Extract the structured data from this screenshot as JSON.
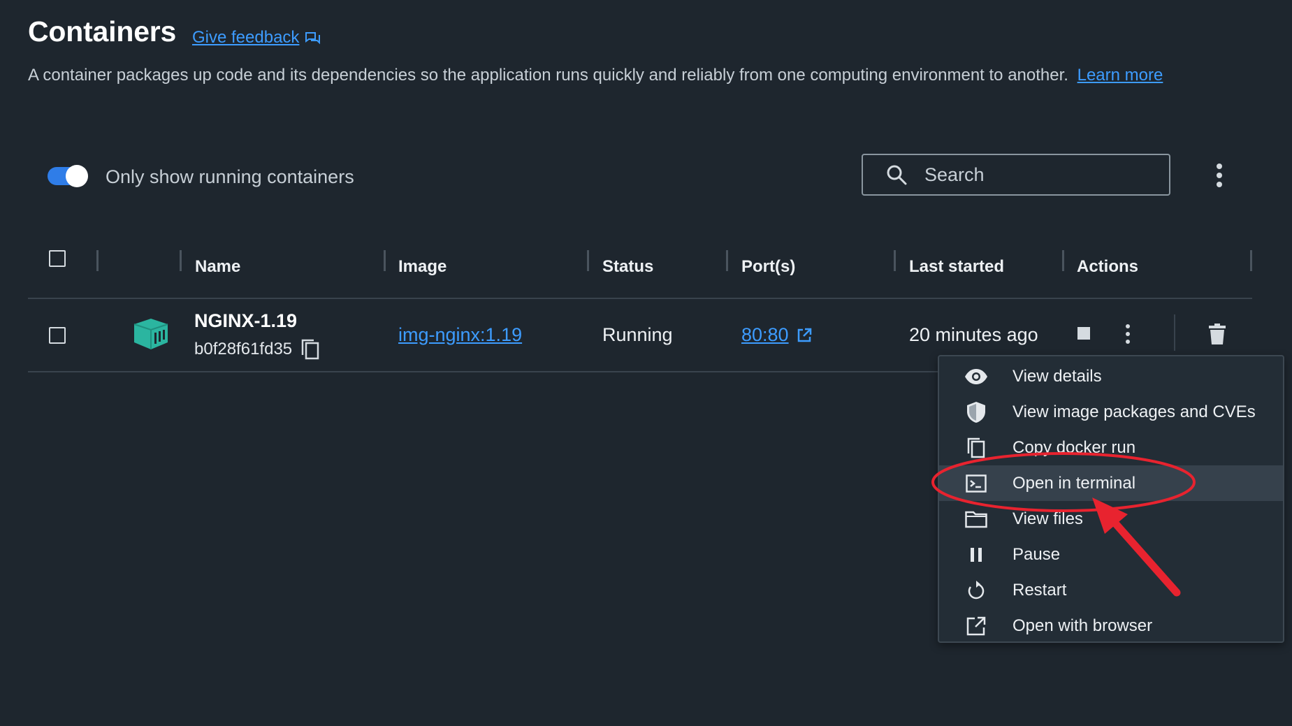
{
  "header": {
    "title": "Containers",
    "feedback_label": "Give feedback",
    "description": "A container packages up code and its dependencies so the application runs quickly and reliably from one computing environment to another.",
    "learn_more": "Learn more"
  },
  "filter": {
    "toggle_label": "Only show running containers",
    "toggle_on": true
  },
  "search": {
    "placeholder": "Search"
  },
  "table": {
    "columns": [
      "Name",
      "Image",
      "Status",
      "Port(s)",
      "Last started",
      "Actions"
    ],
    "rows": [
      {
        "name": "NGINX-1.19",
        "id": "b0f28f61fd35",
        "image": "img-nginx:1.19",
        "status": "Running",
        "port": "80:80",
        "last_started": "20 minutes ago"
      }
    ]
  },
  "menu": {
    "items": [
      {
        "label": "View details",
        "icon": "eye-icon"
      },
      {
        "label": "View image packages and CVEs",
        "icon": "shield-icon"
      },
      {
        "label": "Copy docker run",
        "icon": "copy-icon"
      },
      {
        "label": "Open in terminal",
        "icon": "terminal-icon",
        "highlighted": true
      },
      {
        "label": "View files",
        "icon": "folder-icon"
      },
      {
        "label": "Pause",
        "icon": "pause-icon"
      },
      {
        "label": "Restart",
        "icon": "restart-icon"
      },
      {
        "label": "Open with browser",
        "icon": "external-link-icon"
      }
    ]
  },
  "colors": {
    "background": "#1e262e",
    "accent": "#3d9cff",
    "toggle": "#2f7de8",
    "container_icon": "#2bb5a0",
    "annotation": "#e8232f"
  }
}
